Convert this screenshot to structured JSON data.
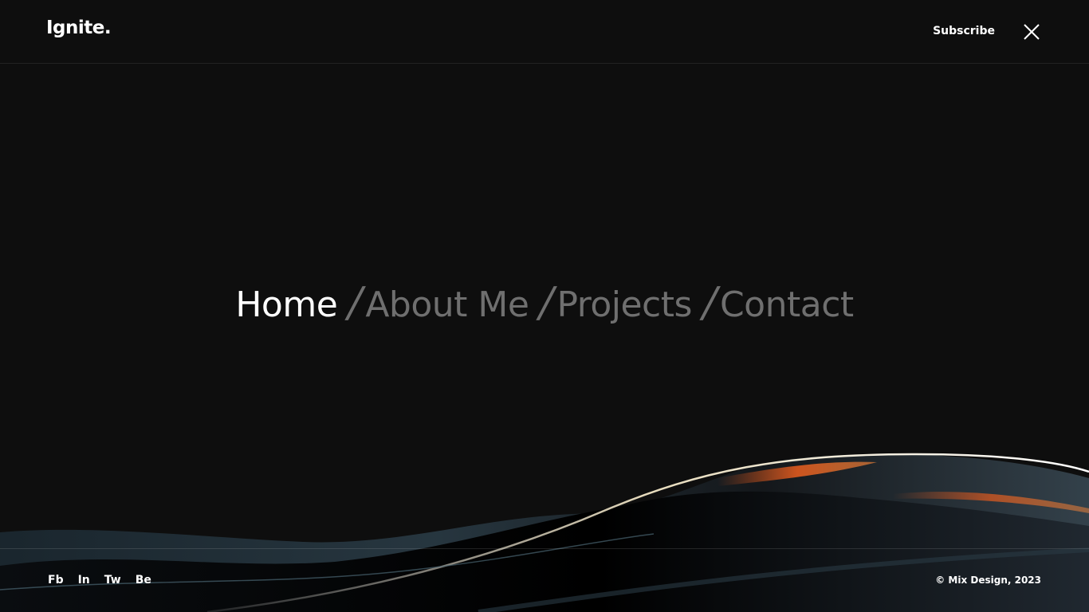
{
  "header": {
    "logo": "Ignite.",
    "subscribe_label": "Subscribe",
    "close_icon": "close-icon"
  },
  "nav": {
    "items": [
      {
        "label": "Home",
        "active": true
      },
      {
        "label": "About Me",
        "active": false
      },
      {
        "label": "Projects",
        "active": false
      },
      {
        "label": "Contact",
        "active": false
      }
    ],
    "separator": "/"
  },
  "footer": {
    "social": [
      "Fb",
      "In",
      "Tw",
      "Be"
    ],
    "copyright": "© Mix Design, 2023"
  },
  "colors": {
    "background": "#0e0e0e",
    "text_active": "#ffffff",
    "text_inactive": "#6f6f6f",
    "wave_accent": "#e05a1e"
  }
}
